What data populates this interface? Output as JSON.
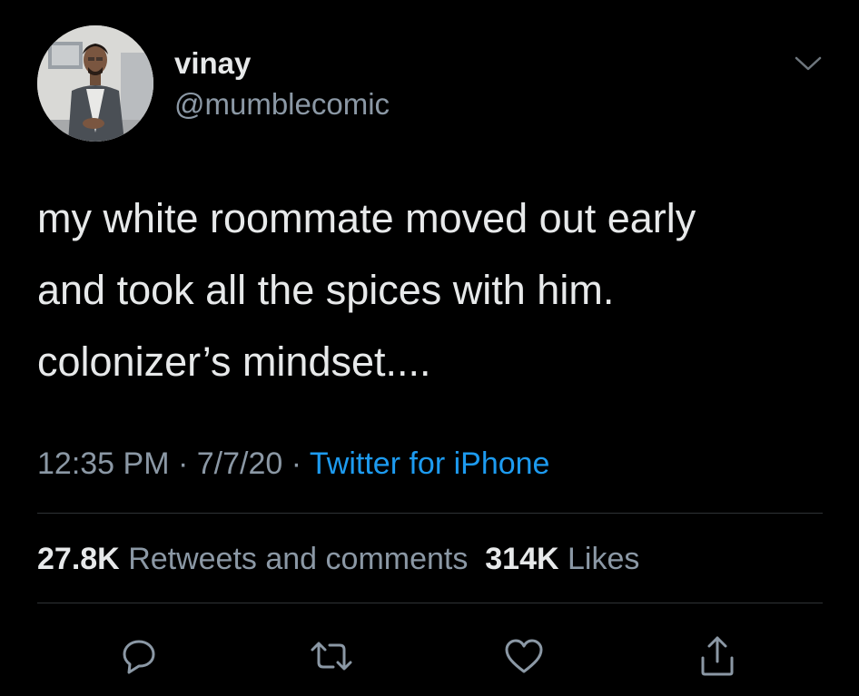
{
  "author": {
    "display_name": "vinay",
    "handle": "@mumblecomic",
    "avatar_icon": "profile-photo"
  },
  "tweet": {
    "lines": [
      "my white roommate moved out early",
      "and took all the spices with him.",
      "colonizer’s mindset...."
    ]
  },
  "meta": {
    "time": "12:35 PM",
    "date": "7/7/20",
    "separator": " · ",
    "source": "Twitter for iPhone"
  },
  "stats": {
    "retweets_count": "27.8K",
    "retweets_label": "Retweets and comments",
    "likes_count": "314K",
    "likes_label": "Likes"
  },
  "actions": {
    "reply_icon": "reply-icon",
    "retweet_icon": "retweet-icon",
    "like_icon": "heart-icon",
    "share_icon": "share-icon"
  },
  "colors": {
    "background": "#000000",
    "text_primary": "#e7e9ea",
    "text_secondary": "#8b98a5",
    "link": "#1d9bf0",
    "divider": "#2f3336"
  }
}
